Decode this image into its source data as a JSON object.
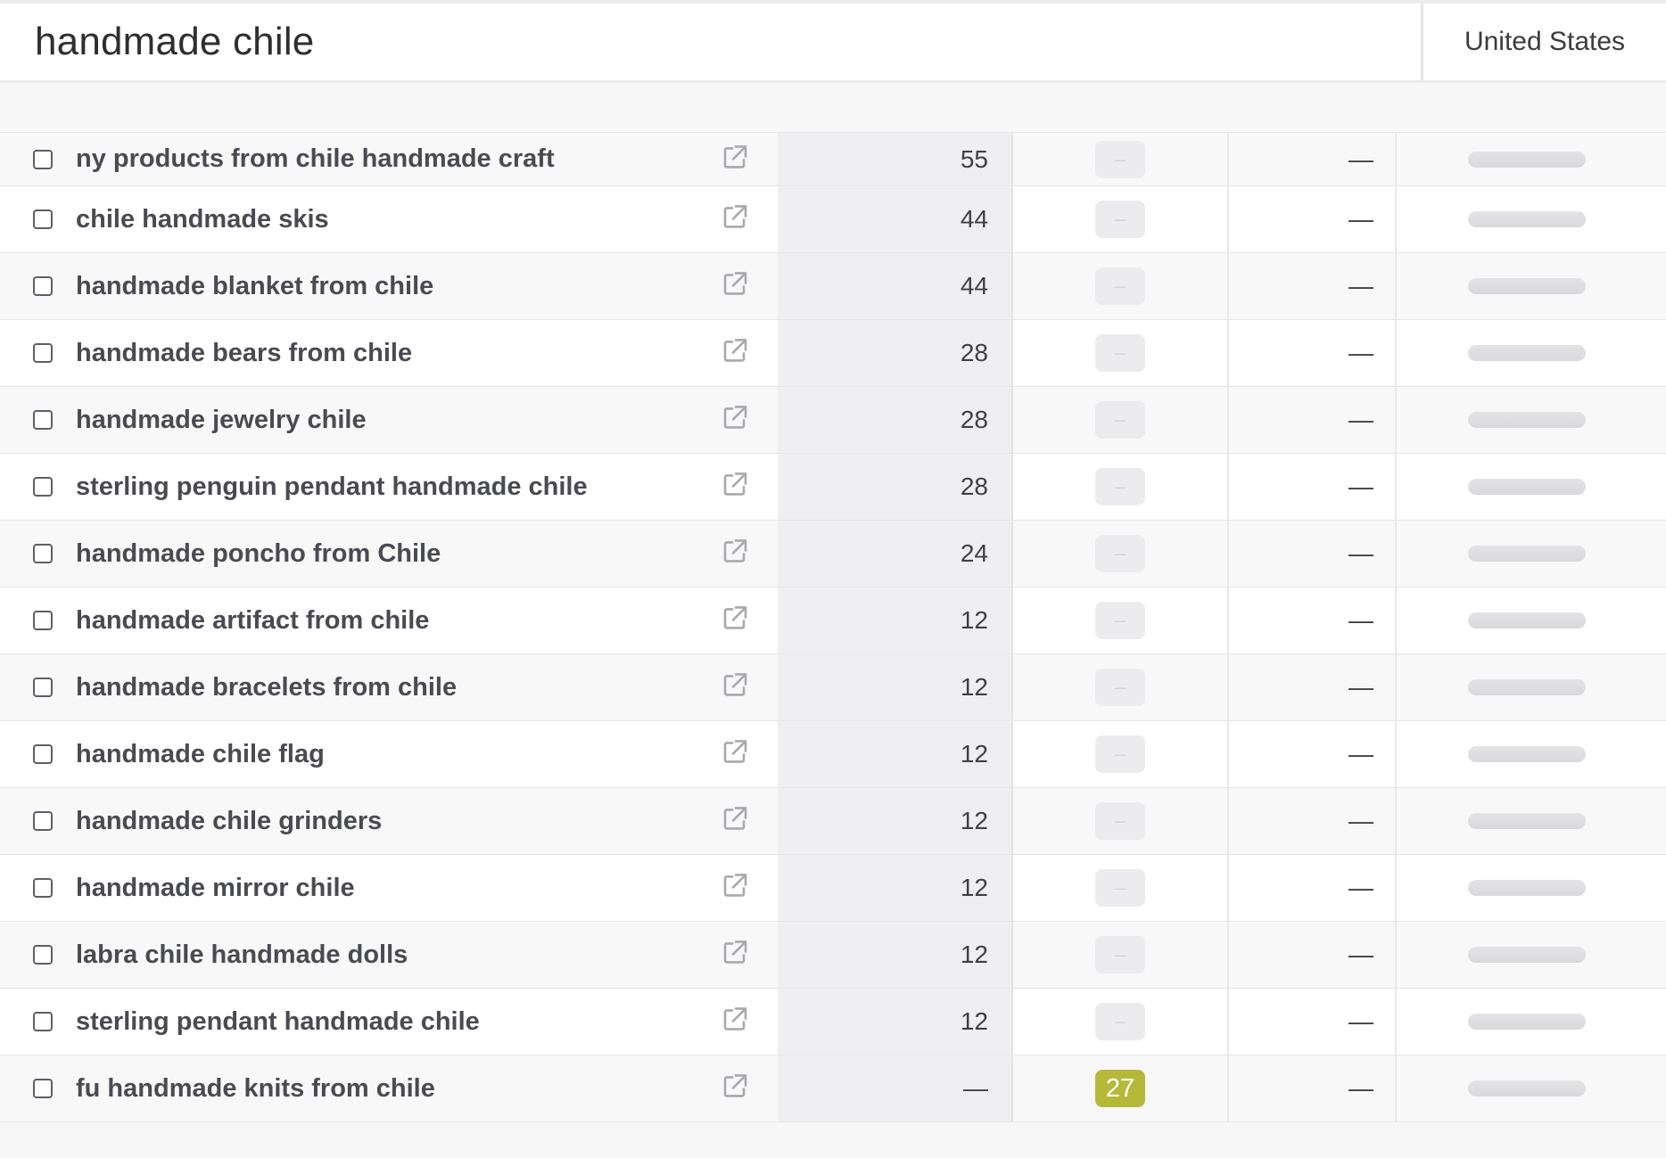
{
  "search": {
    "query": "handmade chile",
    "country": "United States"
  },
  "rows": [
    {
      "keyword": "ny products from chile handmade craft",
      "volume": "55",
      "kd": "–",
      "cpc": "—"
    },
    {
      "keyword": "chile handmade skis",
      "volume": "44",
      "kd": "–",
      "cpc": "—"
    },
    {
      "keyword": "handmade blanket from chile",
      "volume": "44",
      "kd": "–",
      "cpc": "—"
    },
    {
      "keyword": "handmade bears from chile",
      "volume": "28",
      "kd": "–",
      "cpc": "—"
    },
    {
      "keyword": "handmade jewelry chile",
      "volume": "28",
      "kd": "–",
      "cpc": "—"
    },
    {
      "keyword": "sterling penguin pendant handmade chile",
      "volume": "28",
      "kd": "–",
      "cpc": "—"
    },
    {
      "keyword": "handmade poncho from Chile",
      "volume": "24",
      "kd": "–",
      "cpc": "—"
    },
    {
      "keyword": "handmade artifact from chile",
      "volume": "12",
      "kd": "–",
      "cpc": "—"
    },
    {
      "keyword": "handmade bracelets from chile",
      "volume": "12",
      "kd": "–",
      "cpc": "—"
    },
    {
      "keyword": "handmade chile flag",
      "volume": "12",
      "kd": "–",
      "cpc": "—"
    },
    {
      "keyword": "handmade chile grinders",
      "volume": "12",
      "kd": "–",
      "cpc": "—"
    },
    {
      "keyword": "handmade mirror chile",
      "volume": "12",
      "kd": "–",
      "cpc": "—"
    },
    {
      "keyword": "labra chile handmade dolls",
      "volume": "12",
      "kd": "–",
      "cpc": "—"
    },
    {
      "keyword": "sterling pendant handmade chile",
      "volume": "12",
      "kd": "–",
      "cpc": "—"
    },
    {
      "keyword": "fu handmade knits from chile",
      "volume": "—",
      "kd": "27",
      "cpc": "—"
    }
  ],
  "colors": {
    "kd_scored": "#b5b93a",
    "kd_empty": "#ececee"
  },
  "icons": {
    "open_link": "external-link-icon"
  }
}
